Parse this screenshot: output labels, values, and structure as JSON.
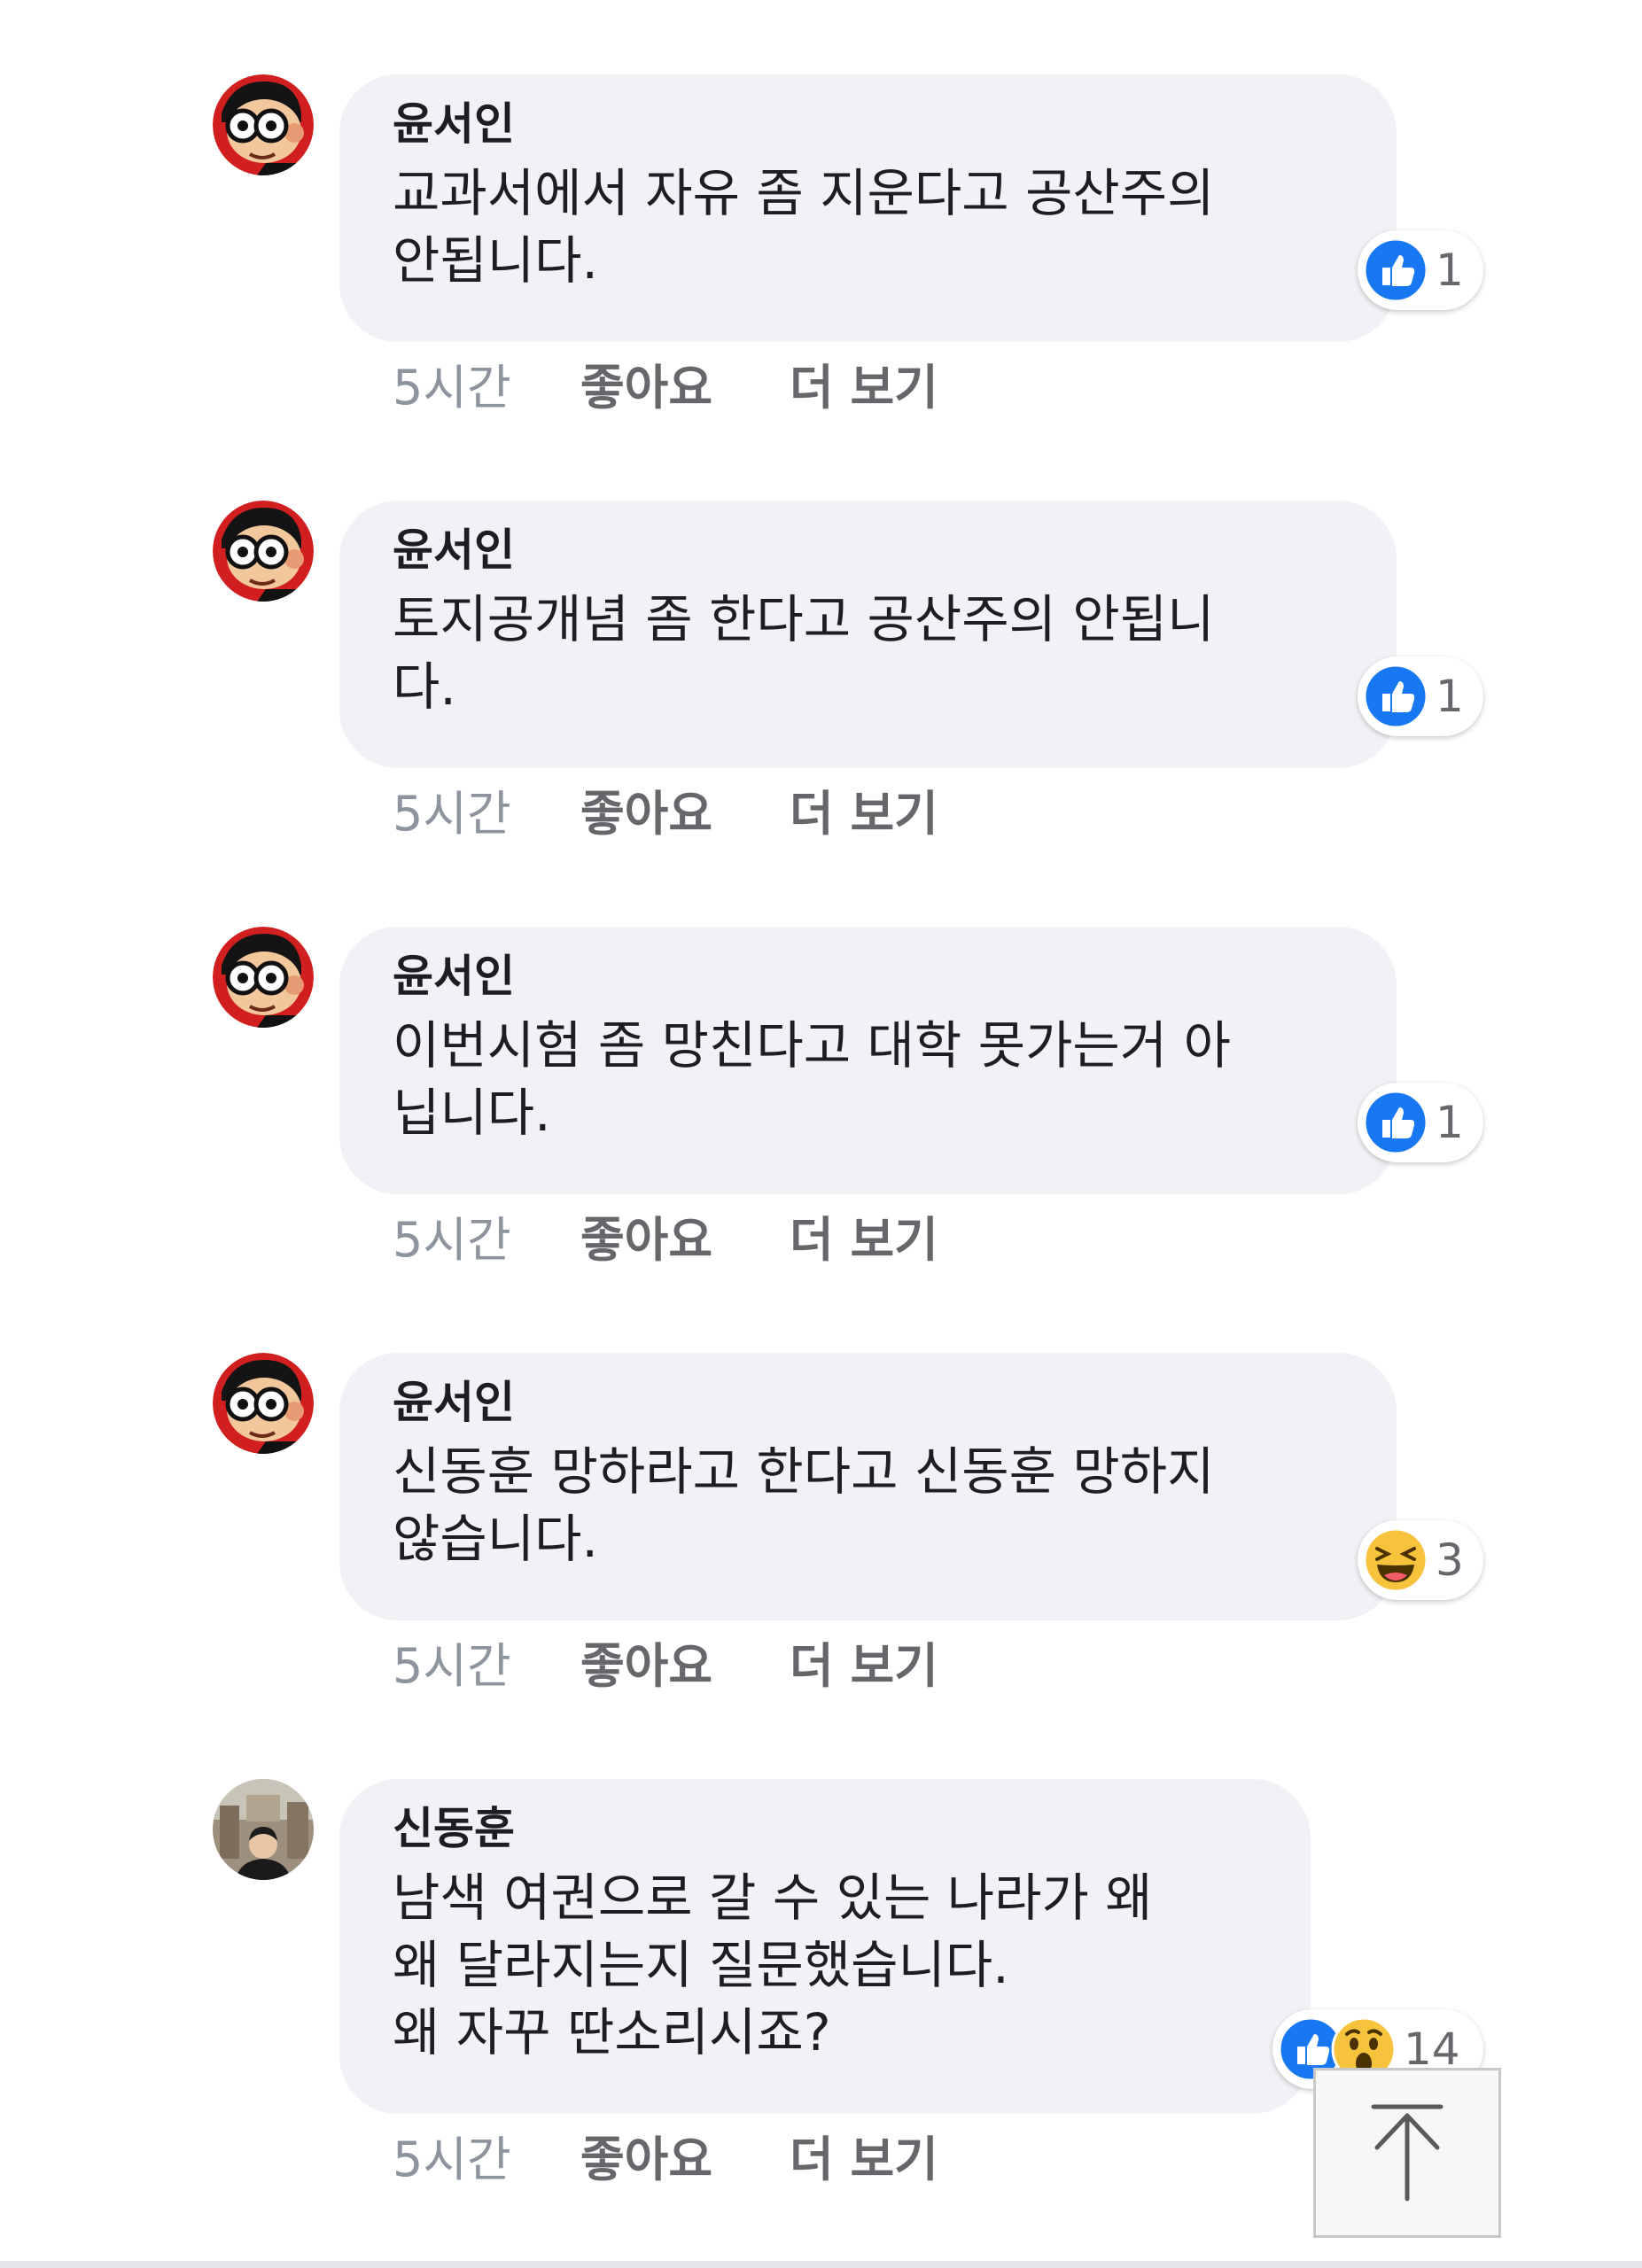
{
  "comments": [
    {
      "author": "윤서인",
      "text": "교과서에서 자유 좀 지운다고 공산주의\n안됩니다.",
      "time": "5시간",
      "like_label": "좋아요",
      "more_label": "더 보기",
      "reaction_count": "1",
      "reaction_icons": [
        "like-icon"
      ]
    },
    {
      "author": "윤서인",
      "text": "토지공개념 좀 한다고 공산주의 안됩니\n다.",
      "time": "5시간",
      "like_label": "좋아요",
      "more_label": "더 보기",
      "reaction_count": "1",
      "reaction_icons": [
        "like-icon"
      ]
    },
    {
      "author": "윤서인",
      "text": "이번시험 좀 망친다고 대학 못가는거 아\n닙니다.",
      "time": "5시간",
      "like_label": "좋아요",
      "more_label": "더 보기",
      "reaction_count": "1",
      "reaction_icons": [
        "like-icon"
      ]
    },
    {
      "author": "윤서인",
      "text": "신동훈 망하라고 한다고 신동훈 망하지\n않습니다.",
      "time": "5시간",
      "like_label": "좋아요",
      "more_label": "더 보기",
      "reaction_count": "3",
      "reaction_icons": [
        "haha-icon"
      ]
    },
    {
      "author": "신동훈",
      "text": "남색 여권으로 갈 수 있는 나라가 왜\n왜 달라지는지 질문했습니다.\n왜 자꾸 딴소리시죠?",
      "time": "5시간",
      "like_label": "좋아요",
      "more_label": "더 보기",
      "reaction_count": "14",
      "reaction_icons": [
        "like-icon",
        "wow-icon"
      ]
    }
  ],
  "scroll_top": {
    "icon": "arrow-up-icon"
  },
  "colors": {
    "bubble_bg": "#f0f2f5",
    "like_blue": "#1877f2",
    "meta_gray": "#8d949e",
    "avatar_red": "#d11f1f"
  }
}
